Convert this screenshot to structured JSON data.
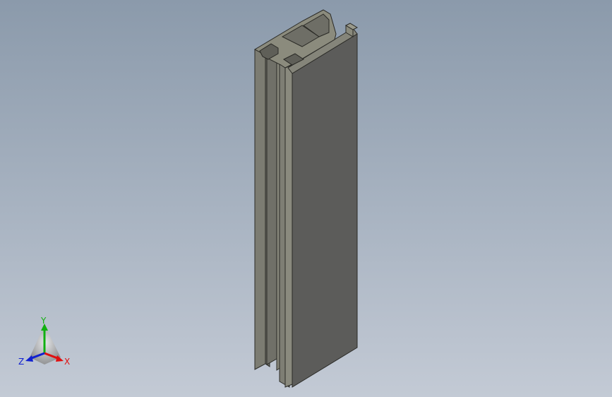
{
  "viewport": {
    "background_top": "#8b9aab",
    "background_bottom": "#c3cad5"
  },
  "model": {
    "name": "aluminum-extrusion-profile",
    "face_colors": {
      "front_face": "#5c5c5a",
      "side_face": "#7e7e74",
      "top_face": "#8a8a7c",
      "edge": "#2a2a26"
    }
  },
  "triad": {
    "x_label": "X",
    "y_label": "Y",
    "z_label": "Z",
    "x_color": "#e01010",
    "y_color": "#10b010",
    "z_color": "#1020d0"
  }
}
